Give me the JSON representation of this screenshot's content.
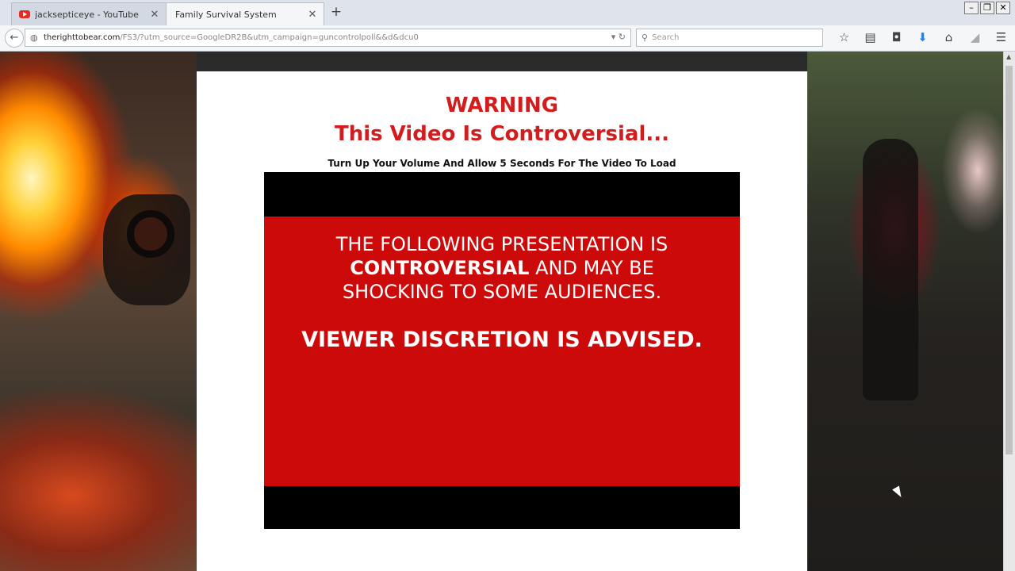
{
  "tabs": [
    {
      "title": "jacksepticeye - YouTube",
      "active": false
    },
    {
      "title": "Family Survival System",
      "active": true
    }
  ],
  "nav": {
    "url_domain": "therighttobear.com",
    "url_path": "/FS3/?utm_source=GoogleDR2B&utm_campaign=guncontrolpoll&&d&dcu0",
    "search_placeholder": "Search"
  },
  "page": {
    "warning_line1": "WARNING",
    "warning_line2": "This Video Is Controversial...",
    "subtitle": "Turn Up Your Volume And Allow 5 Seconds For The Video To Load",
    "video": {
      "line1": "THE FOLLOWING PRESENTATION IS",
      "line2_bold": "CONTROVERSIAL",
      "line2_rest": " AND MAY BE",
      "line3": "SHOCKING TO SOME AUDIENCES.",
      "discretion": "VIEWER DISCRETION IS ADVISED."
    }
  },
  "colors": {
    "warning_red": "#d11d1d",
    "video_red": "#cc0a0a"
  }
}
